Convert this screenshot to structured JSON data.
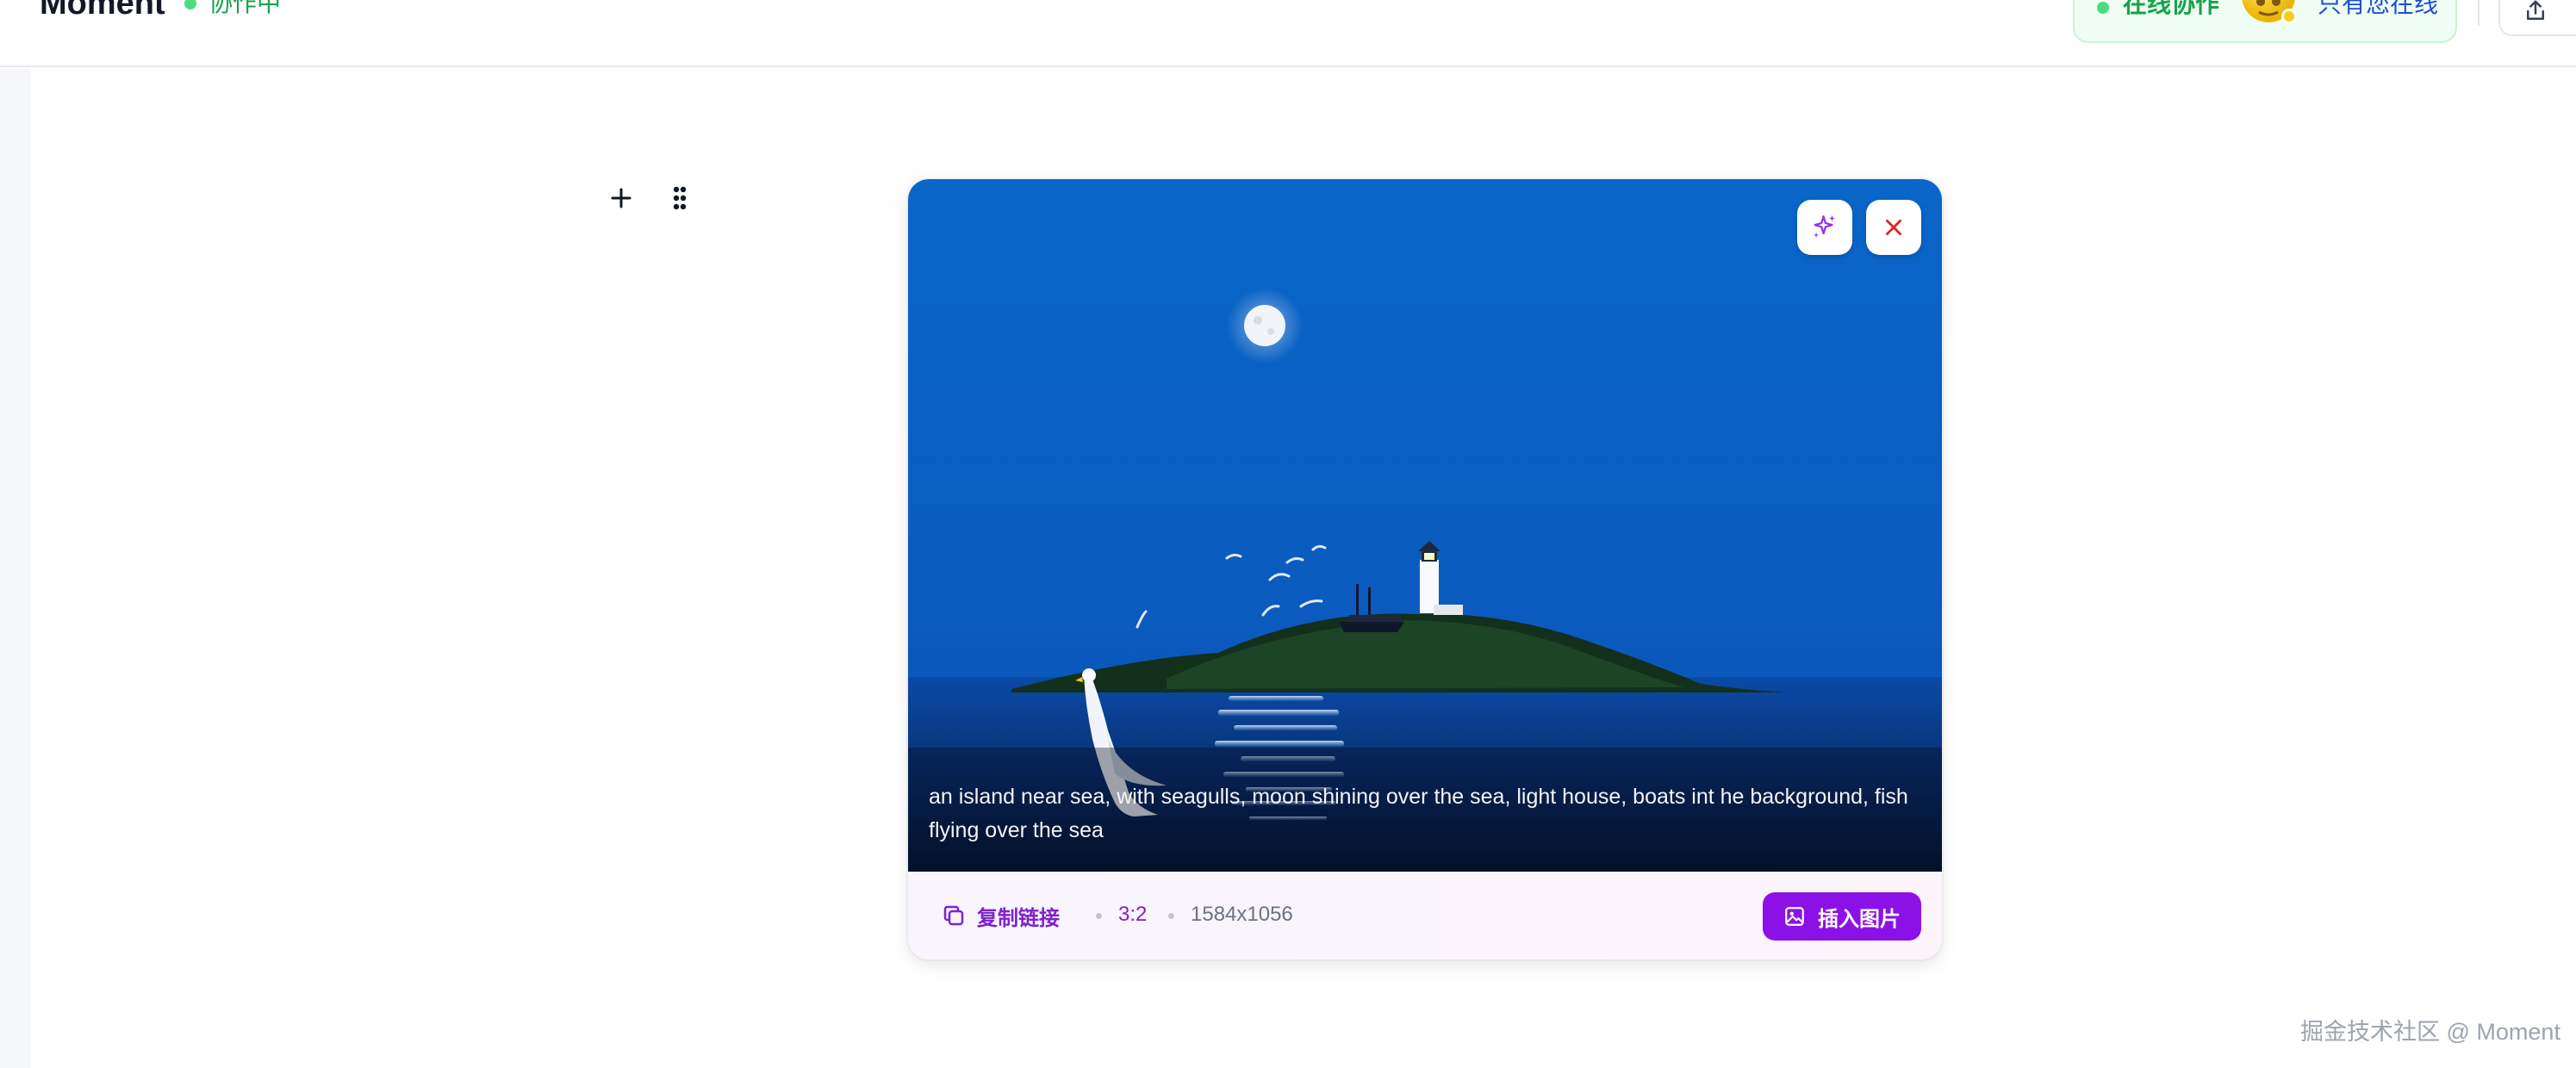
{
  "header": {
    "title": "Moment",
    "collab_status": "协作中",
    "online_label": "在线协作",
    "online_users_text": "只有您在线"
  },
  "image_block": {
    "caption": "an island near sea, with seagulls, moon shining over the sea, light house, boats int he background, fish flying over the sea",
    "copy_link_label": "复制链接",
    "aspect_ratio": "3:2",
    "dimensions": "1584x1056",
    "insert_label": "插入图片"
  },
  "watermark": "掘金技术社区 @ Moment",
  "icons": {
    "add": "plus-icon",
    "drag": "drag-handle-icon",
    "ai": "sparkles-icon",
    "close": "close-icon",
    "copy": "copy-icon",
    "insert": "image-icon",
    "share": "share-icon"
  },
  "colors": {
    "accent_purple": "#8b11e6",
    "success_green": "#16a34a",
    "link_blue": "#1d4ed8",
    "close_red": "#dc2626"
  }
}
